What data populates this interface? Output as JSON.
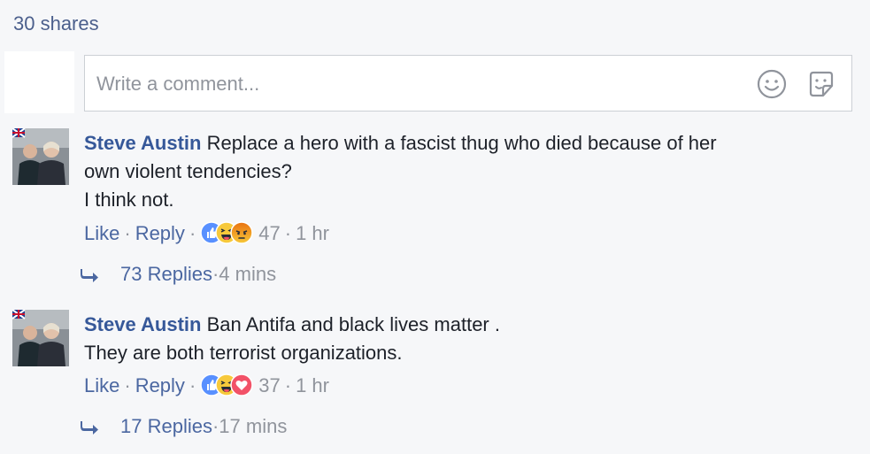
{
  "share_count": "30 shares",
  "composer": {
    "placeholder": "Write a comment..."
  },
  "icons": {
    "emoji": "smiley-face-icon",
    "sticker": "sticker-icon",
    "reply_arrow": "reply-arrow-icon",
    "like": "like-reaction-icon",
    "haha": "haha-reaction-icon",
    "angry": "angry-reaction-icon",
    "love": "love-reaction-icon"
  },
  "colors": {
    "link": "#365899",
    "muted": "#90949c",
    "like_blue": "#5890ff",
    "angry_orange": "#e9710f",
    "love_red": "#f25268"
  },
  "comments": [
    {
      "author": "Steve Austin",
      "lines": [
        "Replace a hero with a fascist thug who died because of her",
        "own violent tendencies?",
        "I think not."
      ],
      "like_label": "Like",
      "reply_label": "Reply",
      "reaction_count": "47",
      "time": "1 hr",
      "reactions": [
        "like",
        "haha",
        "angry"
      ],
      "replies_label": "73 Replies",
      "replies_time": "4 mins"
    },
    {
      "author": "Steve Austin",
      "lines": [
        "Ban Antifa and black lives matter .",
        "They are both terrorist organizations."
      ],
      "like_label": "Like",
      "reply_label": "Reply",
      "reaction_count": "37",
      "time": "1 hr",
      "reactions": [
        "like",
        "haha",
        "love"
      ],
      "replies_label": "17 Replies",
      "replies_time": "17 mins"
    }
  ]
}
